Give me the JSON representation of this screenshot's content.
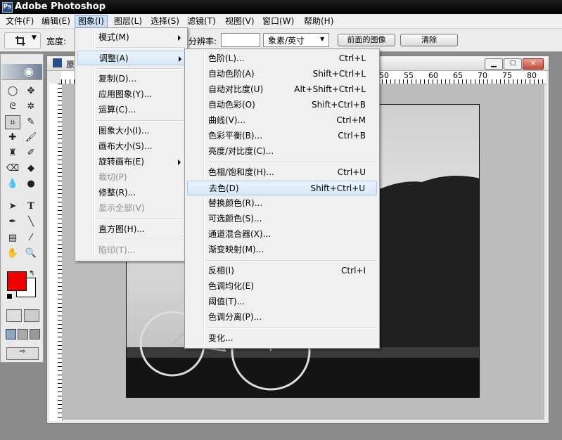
{
  "window": {
    "title": "Adobe Photoshop"
  },
  "menubar": [
    "文件(F)",
    "编辑(E)",
    "图象(I)",
    "图层(L)",
    "选择(S)",
    "滤镜(T)",
    "视图(V)",
    "窗口(W)",
    "帮助(H)"
  ],
  "options": {
    "width_label": "宽度:",
    "resolution_label": "分辨率:",
    "resolution_unit": "象素/英寸",
    "front_image_button": "前面的图像",
    "clear_button": "清除"
  },
  "document": {
    "title_fragment": "原",
    "ruler_ticks": [
      "50",
      "55",
      "60",
      "65",
      "70",
      "75",
      "80"
    ]
  },
  "image_menu": {
    "items": [
      {
        "label": "模式(M)",
        "submenu": true
      },
      {
        "label": "调整(A)",
        "submenu": true,
        "active": true
      },
      {
        "label": "复制(D)..."
      },
      {
        "label": "应用图象(Y)..."
      },
      {
        "label": "运算(C)..."
      },
      {
        "label": "图象大小(I)..."
      },
      {
        "label": "画布大小(S)..."
      },
      {
        "label": "旋转画布(E)",
        "submenu": true
      },
      {
        "label": "裁切(P)",
        "disabled": true
      },
      {
        "label": "修整(R)..."
      },
      {
        "label": "显示全部(V)",
        "disabled": true
      },
      {
        "label": "直方图(H)..."
      },
      {
        "label": "陷印(T)...",
        "disabled": true
      }
    ]
  },
  "adjust_menu": {
    "items": [
      {
        "label": "色阶(L)...",
        "shortcut": "Ctrl+L"
      },
      {
        "label": "自动色阶(A)",
        "shortcut": "Shift+Ctrl+L"
      },
      {
        "label": "自动对比度(U)",
        "shortcut": "Alt+Shift+Ctrl+L"
      },
      {
        "label": "自动色彩(O)",
        "shortcut": "Shift+Ctrl+B"
      },
      {
        "label": "曲线(V)...",
        "shortcut": "Ctrl+M"
      },
      {
        "label": "色彩平衡(B)...",
        "shortcut": "Ctrl+B"
      },
      {
        "label": "亮度/对比度(C)...",
        "shortcut": ""
      },
      {
        "label": "色相/饱和度(H)...",
        "shortcut": "Ctrl+U"
      },
      {
        "label": "去色(D)",
        "shortcut": "Shift+Ctrl+U",
        "highlighted": true
      },
      {
        "label": "替换颜色(R)...",
        "shortcut": ""
      },
      {
        "label": "可选颜色(S)...",
        "shortcut": ""
      },
      {
        "label": "通道混合器(X)...",
        "shortcut": ""
      },
      {
        "label": "渐变映射(M)...",
        "shortcut": ""
      },
      {
        "label": "反相(I)",
        "shortcut": "Ctrl+I"
      },
      {
        "label": "色调均化(E)",
        "shortcut": ""
      },
      {
        "label": "阈值(T)...",
        "shortcut": ""
      },
      {
        "label": "色调分离(P)...",
        "shortcut": ""
      },
      {
        "label": "变化...",
        "shortcut": ""
      }
    ]
  },
  "colors": {
    "foreground": "#ee0000",
    "background": "#ffffff",
    "menu_highlight": "#d8e8f8",
    "menubar_active": "#cde0f5"
  }
}
